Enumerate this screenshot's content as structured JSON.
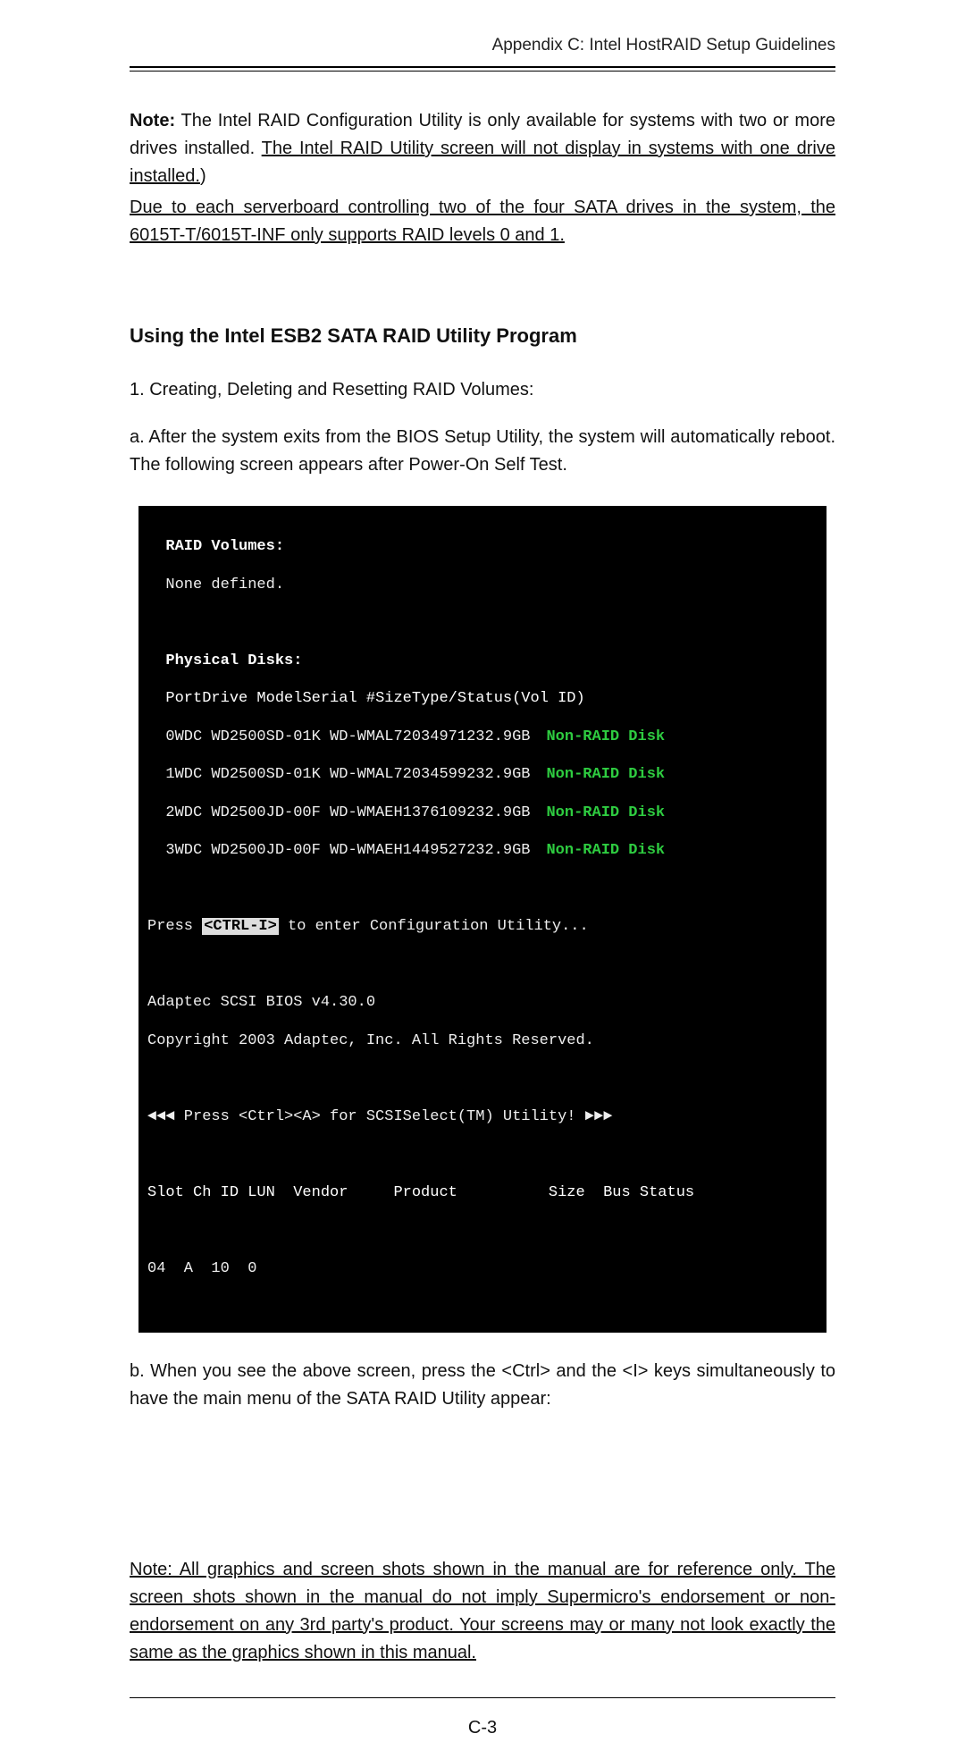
{
  "header": {
    "running_head": "Appendix C: Intel HostRAID Setup Guidelines"
  },
  "intro": {
    "note_label": "Note:",
    "note_text": " The Intel RAID Configuration Utility is only available for systems with two or more drives installed. ",
    "note_underlined": "The Intel RAID Utility screen will not display in systems with one drive installed.",
    "note_close": ")",
    "due_text": "Due to each serverboard controlling two of the four SATA drives in the system, the 6015T-T/6015T-INF only supports RAID levels 0 and 1."
  },
  "section": {
    "title": "Using the Intel ESB2 SATA RAID Utility Program",
    "step1": "1. Creating, Deleting and Resetting RAID Volumes:",
    "step1a": "a. After the system exits from the BIOS Setup Utility, the system will automatically reboot. The following screen appears after Power-On Self Test."
  },
  "terminal": {
    "raid_volumes_label": "RAID Volumes:",
    "none_defined": "None defined.",
    "phys_disks_label": "Physical Disks:",
    "hdr_port": "Port",
    "hdr_model": "Drive Model",
    "hdr_serial": "Serial #",
    "hdr_size": "Size",
    "hdr_type": "Type/Status(Vol ID)",
    "disks": [
      {
        "port": "0",
        "model": "WDC WD2500SD-01K WD-WMAL72034971",
        "size": "232.9GB",
        "type": "Non-RAID Disk"
      },
      {
        "port": "1",
        "model": "WDC WD2500SD-01K WD-WMAL72034599",
        "size": "232.9GB",
        "type": "Non-RAID Disk"
      },
      {
        "port": "2",
        "model": "WDC WD2500JD-00F WD-WMAEH1376109",
        "size": "232.9GB",
        "type": "Non-RAID Disk"
      },
      {
        "port": "3",
        "model": "WDC WD2500JD-00F WD-WMAEH1449527",
        "size": "232.9GB",
        "type": "Non-RAID Disk"
      }
    ],
    "press_pre": "Press ",
    "press_key": "<CTRL-I>",
    "press_post": " to enter Configuration Utility...",
    "adaptec_bios": "Adaptec SCSI BIOS v4.30.0",
    "adaptec_copy": "Copyright 2003 Adaptec, Inc. All Rights Reserved.",
    "scsiselect": "◄◄◄ Press <Ctrl><A> for SCSISelect(TM) Utility! ►►►",
    "slot_hdr": "Slot Ch ID LUN  Vendor     Product          Size  Bus Status",
    "slot_row": "04  A  10  0"
  },
  "after": {
    "step1b": "b. When you see the above screen, press the <Ctrl> and the <I> keys simultaneously to have the main menu of the SATA RAID Utility appear:"
  },
  "footnote": {
    "text": "Note: All graphics and screen shots shown in the manual are for reference only.  The screen shots shown in the manual do not imply Supermicro's endorsement or non-endorsement on any 3rd party's product.  Your screens may or many not look exactly the same as the graphics shown in this manual."
  },
  "page_number": "C-3"
}
